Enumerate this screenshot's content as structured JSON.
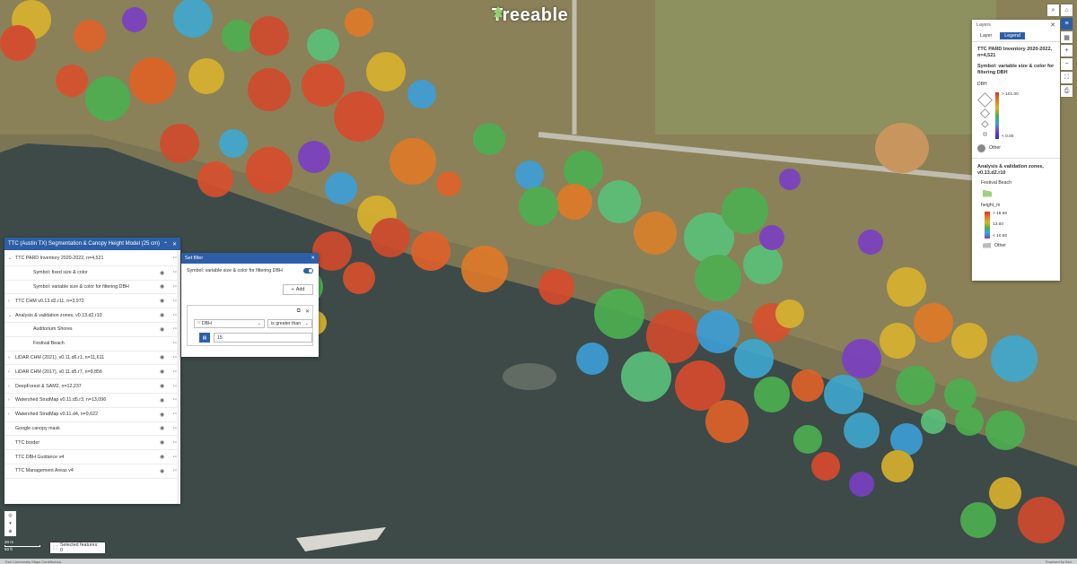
{
  "brand": {
    "name": "Treeable"
  },
  "layers_panel": {
    "title": "TTC (Austin TX) Segmentation & Canopy Height Model (25 cm)",
    "items": [
      {
        "label": "TTC PARD Inventory 2020-2022, n=4,521",
        "expanded": true,
        "child": false,
        "eye": false
      },
      {
        "label": "Symbol: fixed size & color",
        "child": true,
        "eye": true
      },
      {
        "label": "Symbol: variable size & color for filtering DBH",
        "child": true,
        "eye": true
      },
      {
        "label": "TTC CHM v0.13.d2.r11, n=3,972",
        "expanded": false,
        "child": false,
        "eye": true
      },
      {
        "label": "Analysis & validation zones, v0.13.d2.r10",
        "expanded": true,
        "child": false,
        "eye": true
      },
      {
        "label": "Auditorium Shores",
        "child": true,
        "eye": true
      },
      {
        "label": "Festival Beach",
        "child": true,
        "eye": false
      },
      {
        "label": "LiDAR CHM (2021), v0.11.d6.r1, n=11,611",
        "expanded": false,
        "child": false,
        "eye": true
      },
      {
        "label": "LiDAR CHM (2017), v0.11.d5.r7, n=9,856",
        "expanded": false,
        "child": false,
        "eye": true
      },
      {
        "label": "DeepForest & SAM2, n=12,237",
        "expanded": false,
        "child": false,
        "eye": true
      },
      {
        "label": "Watershed StratMap v0.11.d5.r3, n=13,096",
        "expanded": false,
        "child": false,
        "eye": true
      },
      {
        "label": "Watershed StratMap v0.11.d4, n=9,622",
        "expanded": false,
        "child": false,
        "eye": true
      },
      {
        "label": "Google canopy mask",
        "child": false,
        "eye": true,
        "noexp": true
      },
      {
        "label": "TTC border",
        "child": false,
        "eye": true,
        "noexp": true
      },
      {
        "label": "TTC DBH Guidance v4",
        "child": false,
        "eye": true,
        "noexp": true
      },
      {
        "label": "TTC Management Areas v4",
        "child": false,
        "eye": true,
        "noexp": true
      }
    ]
  },
  "filter_panel": {
    "title": "Set filter",
    "layer_label": "Symbol: variable size & color for filtering DBH",
    "add_label": "Add",
    "field": "DBH",
    "operator": "is greater than",
    "value": "15"
  },
  "legend_panel": {
    "header": "Layers",
    "tabs": [
      "Layer",
      "Legend"
    ],
    "active_tab": "Legend",
    "layer_title": "TTC PARD Inventory 2020-2022, n=4,521",
    "symbol_title": "Symbol: variable size & color for filtering DBH",
    "dbh_label": "DBH",
    "dbh_max": "> 101.00",
    "dbh_min": "< 0.00",
    "other_label": "Other",
    "zones_title": "Analysis & validation zones, v0.13.d2.r10",
    "zone_name": "Festival Beach",
    "height_label": "height_m",
    "height_max": "> 16.60",
    "height_mid": "13.60",
    "height_min": "< 10.60",
    "other2_label": "Other"
  },
  "status": {
    "selected_features": "Selected features: 0"
  },
  "scale": {
    "top": "20 m",
    "bottom": "50 ft"
  },
  "attribution": {
    "left": "Esri Community Maps Contributors",
    "right": "Powered by Esri"
  },
  "colors": {
    "accent": "#2d5fa8",
    "water": "#3b4a4a",
    "grass": "#9a8f62"
  }
}
